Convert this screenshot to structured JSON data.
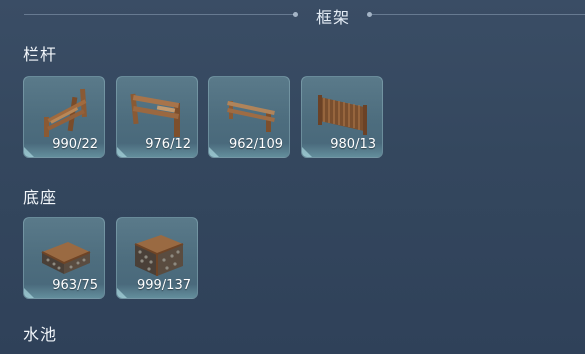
{
  "header": {
    "title": "框架"
  },
  "categories": {
    "railing": {
      "label": "栏杆",
      "items": [
        {
          "icon": "slanted-log-fence-icon",
          "count": "990/22"
        },
        {
          "icon": "double-rail-wood-fence-icon",
          "count": "976/12"
        },
        {
          "icon": "low-rail-fence-icon",
          "count": "962/109"
        },
        {
          "icon": "woven-panel-fence-icon",
          "count": "980/13"
        }
      ]
    },
    "base": {
      "label": "底座",
      "items": [
        {
          "icon": "low-wood-stone-base-icon",
          "count": "963/75"
        },
        {
          "icon": "tall-wood-stone-base-icon",
          "count": "999/137"
        }
      ]
    },
    "pool": {
      "label": "水池"
    }
  },
  "colors": {
    "background": "#364a62",
    "tile": "#527384",
    "wood": "#8a5a34"
  }
}
